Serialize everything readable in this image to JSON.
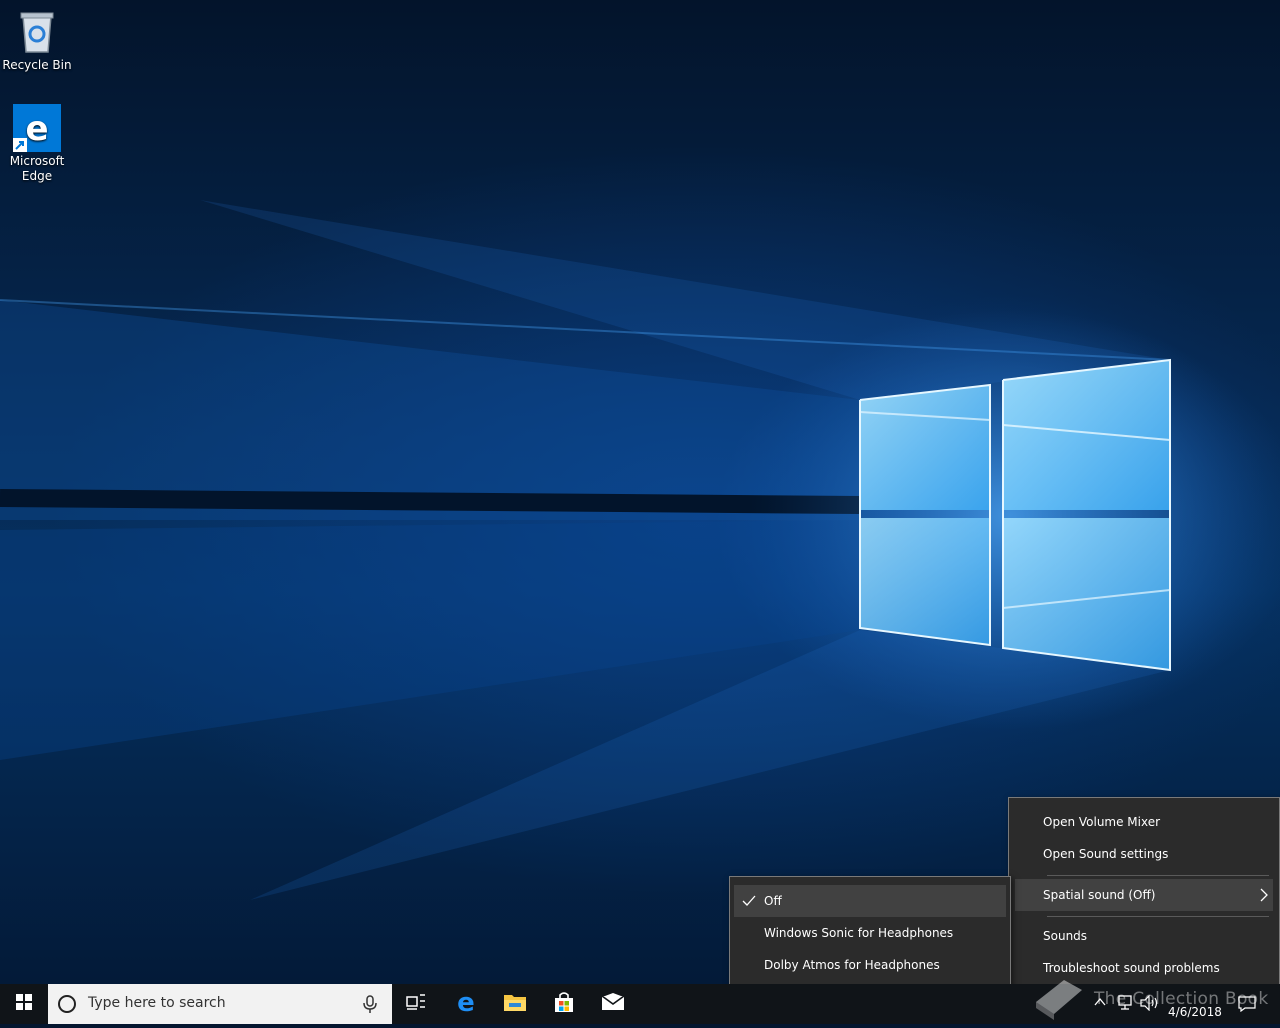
{
  "desktop": {
    "icons": [
      {
        "name": "recycle-bin",
        "label": "Recycle Bin"
      },
      {
        "name": "microsoft-edge",
        "label_line1": "Microsoft",
        "label_line2": "Edge"
      }
    ]
  },
  "taskbar": {
    "search_placeholder": "Type here to search",
    "pinned": [
      "task-view-icon",
      "edge-icon",
      "file-explorer-icon",
      "store-icon",
      "mail-icon"
    ]
  },
  "tray": {
    "date": "4/6/2018",
    "watermark": "The Collection Book"
  },
  "volume_menu": {
    "items": [
      {
        "label": "Open Volume Mixer"
      },
      {
        "label": "Open Sound settings"
      },
      {
        "label": "Spatial sound (Off)"
      },
      {
        "label": "Sounds"
      },
      {
        "label": "Troubleshoot sound problems"
      }
    ]
  },
  "spatial_submenu": {
    "items": [
      {
        "label": "Off",
        "checked": true
      },
      {
        "label": "Windows Sonic for Headphones",
        "checked": false
      },
      {
        "label": "Dolby Atmos for Headphones",
        "checked": false
      }
    ]
  },
  "colors": {
    "accent": "#0078d7",
    "menu_bg": "#2b2b2b",
    "menu_highlight": "#414141",
    "taskbar": "#101418"
  }
}
